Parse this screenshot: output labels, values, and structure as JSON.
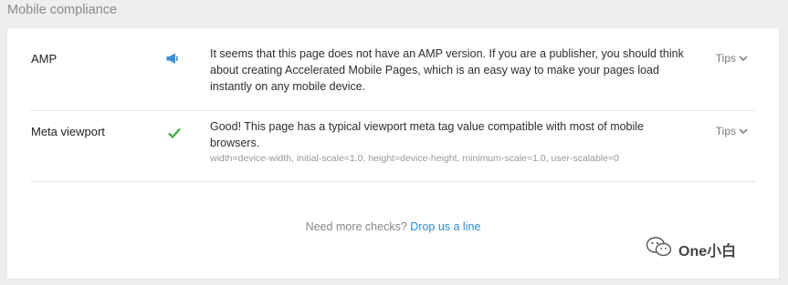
{
  "section": {
    "title": "Mobile compliance"
  },
  "rows": [
    {
      "label": "AMP",
      "status_icon": "megaphone-icon",
      "status_color": "#3b8fd6",
      "description": "It seems that this page does not have an AMP version. If you are a publisher, you should think about creating Accelerated Mobile Pages, which is an easy way to make your pages load instantly on any mobile device.",
      "tips_label": "Tips"
    },
    {
      "label": "Meta viewport",
      "status_icon": "checkmark-icon",
      "status_color": "#3fae3f",
      "description": "Good! This page has a typical viewport meta tag value compatible with most of mobile browsers.",
      "code": "width=device-width, initial-scale=1.0, height=device-height, minimum-scale=1.0, user-scalable=0",
      "tips_label": "Tips"
    }
  ],
  "footer": {
    "prompt": "Need more checks?",
    "link_text": "Drop us a line"
  },
  "watermark": {
    "text": "One小白",
    "icon": "wechat-icon"
  }
}
